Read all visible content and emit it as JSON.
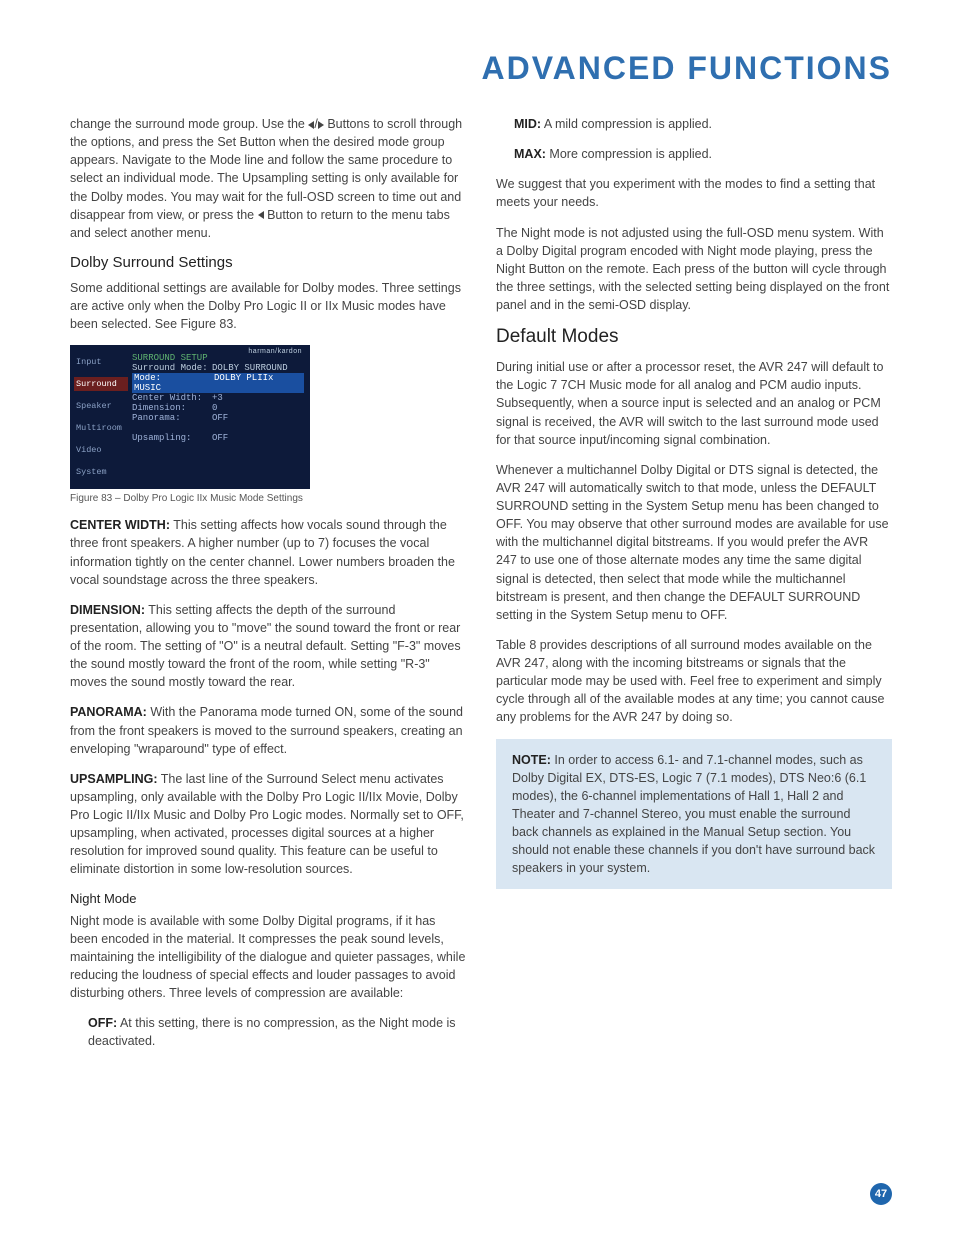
{
  "title": "ADVANCED FUNCTIONS",
  "page_number": "47",
  "left": {
    "intro": "change the surround mode group. Use the  ⁄  Buttons to scroll through the options, and press the Set Button when the desired mode group appears. Navigate to the Mode line and follow the same procedure to select an individual mode. The Upsampling setting is only available for the Dolby modes. You may wait for the full-OSD screen to time out and disappear from view, or press the  Button to return to the menu tabs and select another menu.",
    "dolby_heading": "Dolby Surround Settings",
    "dolby_intro": "Some additional settings are available for Dolby modes. Three settings are active only when the Dolby Pro Logic II or IIx Music modes have been selected. See Figure 83.",
    "figure": {
      "brand": "harman/kardon",
      "tabs": [
        "Input",
        "Surround",
        "Speaker",
        "Multiroom",
        "Video",
        "System"
      ],
      "panel_title": "SURROUND SETUP",
      "rows": [
        {
          "k": "Surround Mode:",
          "v": "DOLBY SURROUND"
        },
        {
          "k": "Mode:",
          "v": "DOLBY PLIIx MUSIC"
        },
        {
          "k": "Center Width:",
          "v": "+3"
        },
        {
          "k": "Dimension:",
          "v": "0"
        },
        {
          "k": "Panorama:",
          "v": "OFF"
        },
        {
          "k": "Upsampling:",
          "v": "OFF"
        }
      ]
    },
    "figure_caption": "Figure 83 – Dolby Pro Logic IIx Music Mode Settings",
    "cw_label": "CENTER WIDTH:",
    "cw_text": " This setting affects how vocals sound through the three front speakers. A higher number (up to 7) focuses the vocal information tightly on the center channel. Lower numbers broaden the vocal soundstage across the three speakers.",
    "dim_label": "DIMENSION:",
    "dim_text": " This setting affects the depth of the surround presentation, allowing you to \"move\" the sound toward the front or rear of the room. The setting of \"O\" is a neutral default. Setting \"F-3\" moves the sound mostly toward the front of the room, while setting \"R-3\" moves the sound mostly toward the rear.",
    "pan_label": "PANORAMA:",
    "pan_text": " With the Panorama mode turned ON, some of the sound from the front speakers is moved to the surround speakers, creating an enveloping \"wraparound\" type of effect.",
    "up_label": "UPSAMPLING:",
    "up_text": " The last line of the Surround Select menu activates upsampling, only available with the Dolby Pro Logic II/IIx Movie, Dolby Pro Logic II/IIx Music and Dolby Pro Logic modes. Normally set to OFF, upsampling, when activated, processes digital sources at a higher resolution for improved sound quality. This feature can be useful to eliminate distortion in some low-resolution sources.",
    "night_heading": "Night Mode",
    "night_intro": "Night mode is available with some Dolby Digital programs, if it has been encoded in the material. It compresses the peak sound levels, maintaining the intelligibility of the dialogue and quieter passages, while reducing the loudness of special effects and louder passages to avoid disturbing others. Three levels of compression are available:",
    "off_label": "OFF:",
    "off_text": " At this setting, there is no compression, as the Night mode is deactivated."
  },
  "right": {
    "mid_label": "MID:",
    "mid_text": " A mild compression is applied.",
    "max_label": "MAX:",
    "max_text": " More compression is applied.",
    "suggest": "We suggest that you experiment with the modes to find a setting that meets your needs.",
    "night_adjust": "The Night mode is not adjusted using the full-OSD menu system. With a Dolby Digital program encoded with Night mode playing, press the Night Button on the remote. Each press of the button will cycle through the three settings, with the selected setting being displayed on the front panel and in the semi-OSD display.",
    "default_heading": "Default Modes",
    "default_p1": "During initial use or after a processor reset, the AVR 247 will default to the Logic 7 7CH Music mode for all analog and PCM audio inputs. Subsequently, when a source input is selected and an analog or PCM signal is received, the AVR will switch to the last surround mode used for that source input/incoming signal combination.",
    "default_p2": "Whenever a multichannel Dolby Digital or DTS signal is detected, the AVR 247 will automatically switch to that mode, unless the DEFAULT SURROUND setting in the System Setup menu has been changed to OFF. You may observe that other surround modes are available for use with the multichannel digital bitstreams. If you would prefer the AVR 247 to use one of those alternate modes any time the same digital signal is detected, then select that mode while the multichannel bitstream is present, and then change the DEFAULT SURROUND setting in the System Setup menu to OFF.",
    "default_p3": "Table 8 provides descriptions of all surround modes available on the AVR 247, along with the incoming bitstreams or signals that the particular mode may be used with. Feel free to experiment and simply cycle through all of the available modes at any time; you cannot cause any problems for the AVR 247 by doing so.",
    "note_label": "NOTE:",
    "note_text": " In order to access 6.1- and 7.1-channel modes, such as Dolby Digital EX, DTS-ES, Logic 7 (7.1 modes), DTS Neo:6 (6.1 modes), the 6-channel implementations of Hall 1, Hall 2 and Theater and 7-channel Stereo, you must enable the surround back channels as explained in the Manual Setup section. You should not enable these channels if you don't have surround back speakers in your system."
  }
}
